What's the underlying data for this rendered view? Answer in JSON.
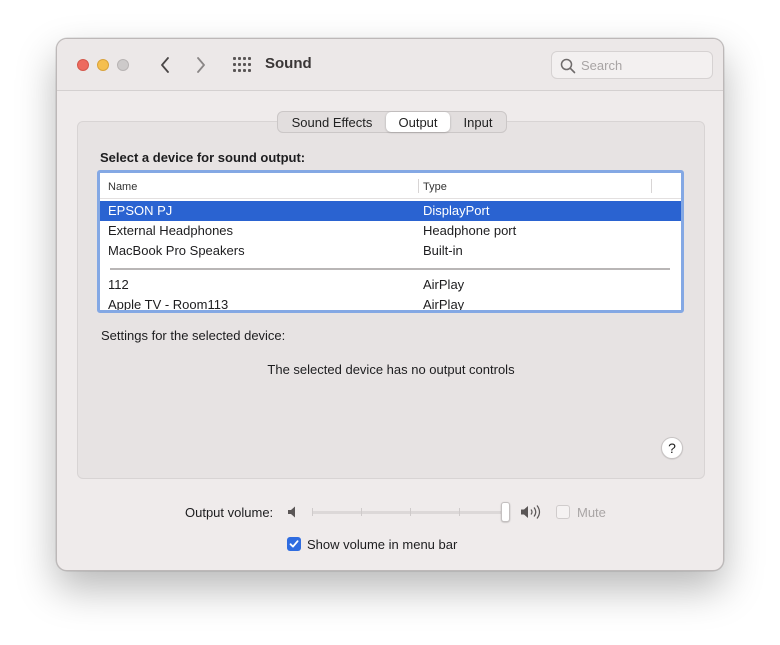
{
  "window": {
    "title": "Sound"
  },
  "toolbar": {
    "back_icon": "chevron-left-icon",
    "forward_icon": "chevron-right-icon",
    "show_all_icon": "grid-icon"
  },
  "search": {
    "placeholder": "Search",
    "icon": "search-icon"
  },
  "tabs": [
    {
      "label": "Sound Effects",
      "active": false
    },
    {
      "label": "Output",
      "active": true
    },
    {
      "label": "Input",
      "active": false
    }
  ],
  "device_select": {
    "label": "Select a device for sound output:",
    "columns": {
      "name": "Name",
      "type": "Type"
    },
    "devices": [
      {
        "name": "EPSON PJ",
        "type": "DisplayPort",
        "selected": true
      },
      {
        "name": "External Headphones",
        "type": "Headphone port",
        "selected": false
      },
      {
        "name": "MacBook Pro Speakers",
        "type": "Built-in",
        "selected": false
      },
      {
        "name": "112",
        "type": "AirPlay",
        "selected": false
      },
      {
        "name": "Apple TV - Room113",
        "type": "AirPlay",
        "selected": false
      }
    ]
  },
  "settings": {
    "label": "Settings for the selected device:",
    "message": "The selected device has no output controls",
    "help_label": "?"
  },
  "volume": {
    "label": "Output volume:",
    "level": 1.0,
    "mute_label": "Mute",
    "mute_checked": false,
    "mute_enabled": false
  },
  "menu_bar": {
    "label": "Show volume in menu bar",
    "checked": true
  },
  "colors": {
    "selection": "#2a63d1",
    "list_focus_ring": "#84a8e4",
    "checkbox_accent": "#2f6ce0",
    "close": "#ed6a5e",
    "minimize": "#f5bf4f",
    "zoom_disabled": "#cdcaca"
  }
}
